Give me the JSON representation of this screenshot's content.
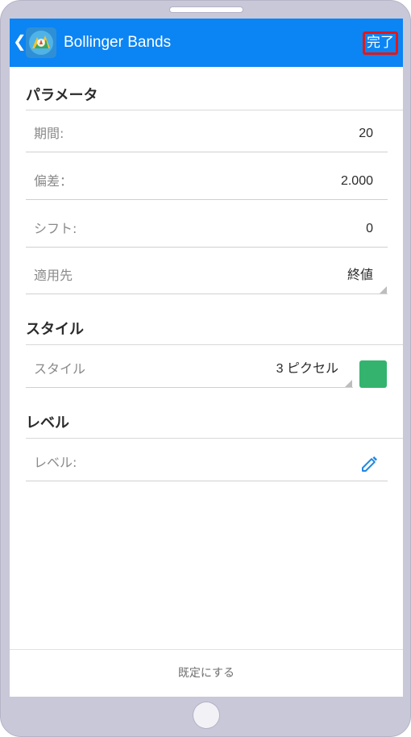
{
  "appbar": {
    "title": "Bollinger Bands",
    "done_label": "完了",
    "icons": {
      "back": "chevron-left-icon",
      "logo": "metatrader-logo-icon"
    },
    "color": "#0b84f4"
  },
  "sections": {
    "parameters": {
      "header": "パラメータ",
      "rows": [
        {
          "label": "期間:",
          "value": "20"
        },
        {
          "label": "偏差：",
          "value": "2.000"
        },
        {
          "label": "シフト:",
          "value": "0"
        },
        {
          "label": "適用先",
          "value": "終値"
        }
      ]
    },
    "style": {
      "header": "スタイル",
      "row": {
        "label": "スタイル",
        "value": "3 ピクセル"
      },
      "swatch_color": "#34b36e"
    },
    "levels": {
      "header": "レベル",
      "row": {
        "label": "レベル:"
      },
      "edit_icon": "pencil-icon"
    }
  },
  "footer": {
    "reset_label": "既定にする"
  }
}
